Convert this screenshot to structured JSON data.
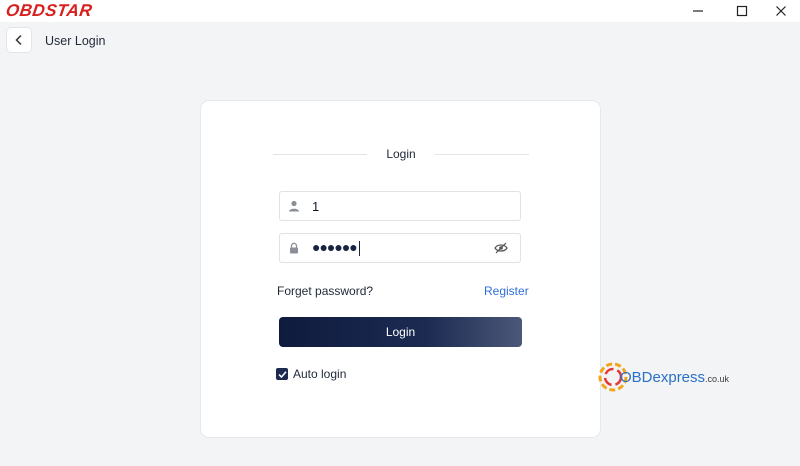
{
  "app": {
    "brand": "OBDSTAR"
  },
  "header": {
    "title": "User Login"
  },
  "login": {
    "title": "Login",
    "username_value": "1",
    "password_mask": "●●●●●●",
    "forget_label": "Forget password?",
    "register_label": "Register",
    "login_button": "Login",
    "auto_login_label": "Auto login",
    "auto_login_checked": true
  },
  "watermark": {
    "text": "OBDexpress",
    "suffix": ".co.uk"
  },
  "icons": {
    "back": "chevron-left-icon",
    "user": "user-icon",
    "lock": "lock-icon",
    "eye": "eye-off-icon"
  },
  "colors": {
    "brand": "#d8201e",
    "primary": "#1c2a52",
    "link": "#2f6fdb",
    "background": "#f3f4f6"
  }
}
